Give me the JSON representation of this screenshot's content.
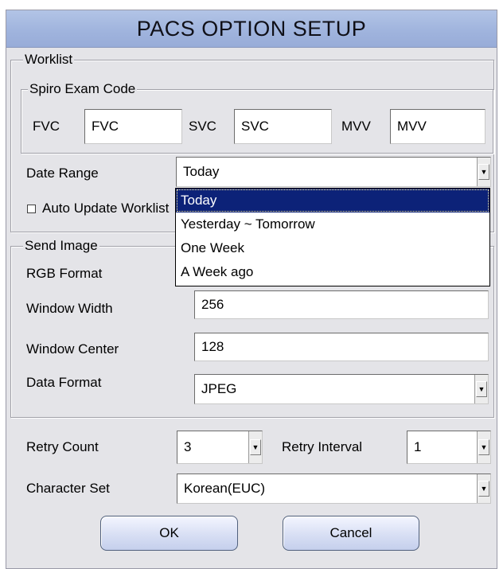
{
  "window": {
    "title": "PACS OPTION SETUP"
  },
  "worklist": {
    "group_label": "Worklist",
    "spiro": {
      "group_label": "Spiro Exam Code",
      "fvc_label": "FVC",
      "fvc_value": "FVC",
      "svc_label": "SVC",
      "svc_value": "SVC",
      "mvv_label": "MVV",
      "mvv_value": "MVV"
    },
    "date_range_label": "Date Range",
    "date_range_value": "Today",
    "date_range_options": [
      "Today",
      "Yesterday ~ Tomorrow",
      "One Week",
      "A Week ago"
    ],
    "auto_update_label": "Auto Update Worklist",
    "auto_update_checked": false
  },
  "send_image": {
    "group_label": "Send Image",
    "rgb_format_label": "RGB Format",
    "window_width_label": "Window Width",
    "window_width_value": "256",
    "window_center_label": "Window Center",
    "window_center_value": "128",
    "data_format_label": "Data Format",
    "data_format_value": "JPEG"
  },
  "retry": {
    "count_label": "Retry Count",
    "count_value": "3",
    "interval_label": "Retry Interval",
    "interval_value": "1"
  },
  "charset": {
    "label": "Character Set",
    "value": "Korean(EUC)"
  },
  "buttons": {
    "ok": "OK",
    "cancel": "Cancel"
  },
  "colors": {
    "title_bar": "#9fb3dd",
    "selection": "#0c2278",
    "dialog_bg": "#e4e4e8"
  },
  "icons": {
    "dropdown": "chevron-down-icon"
  }
}
